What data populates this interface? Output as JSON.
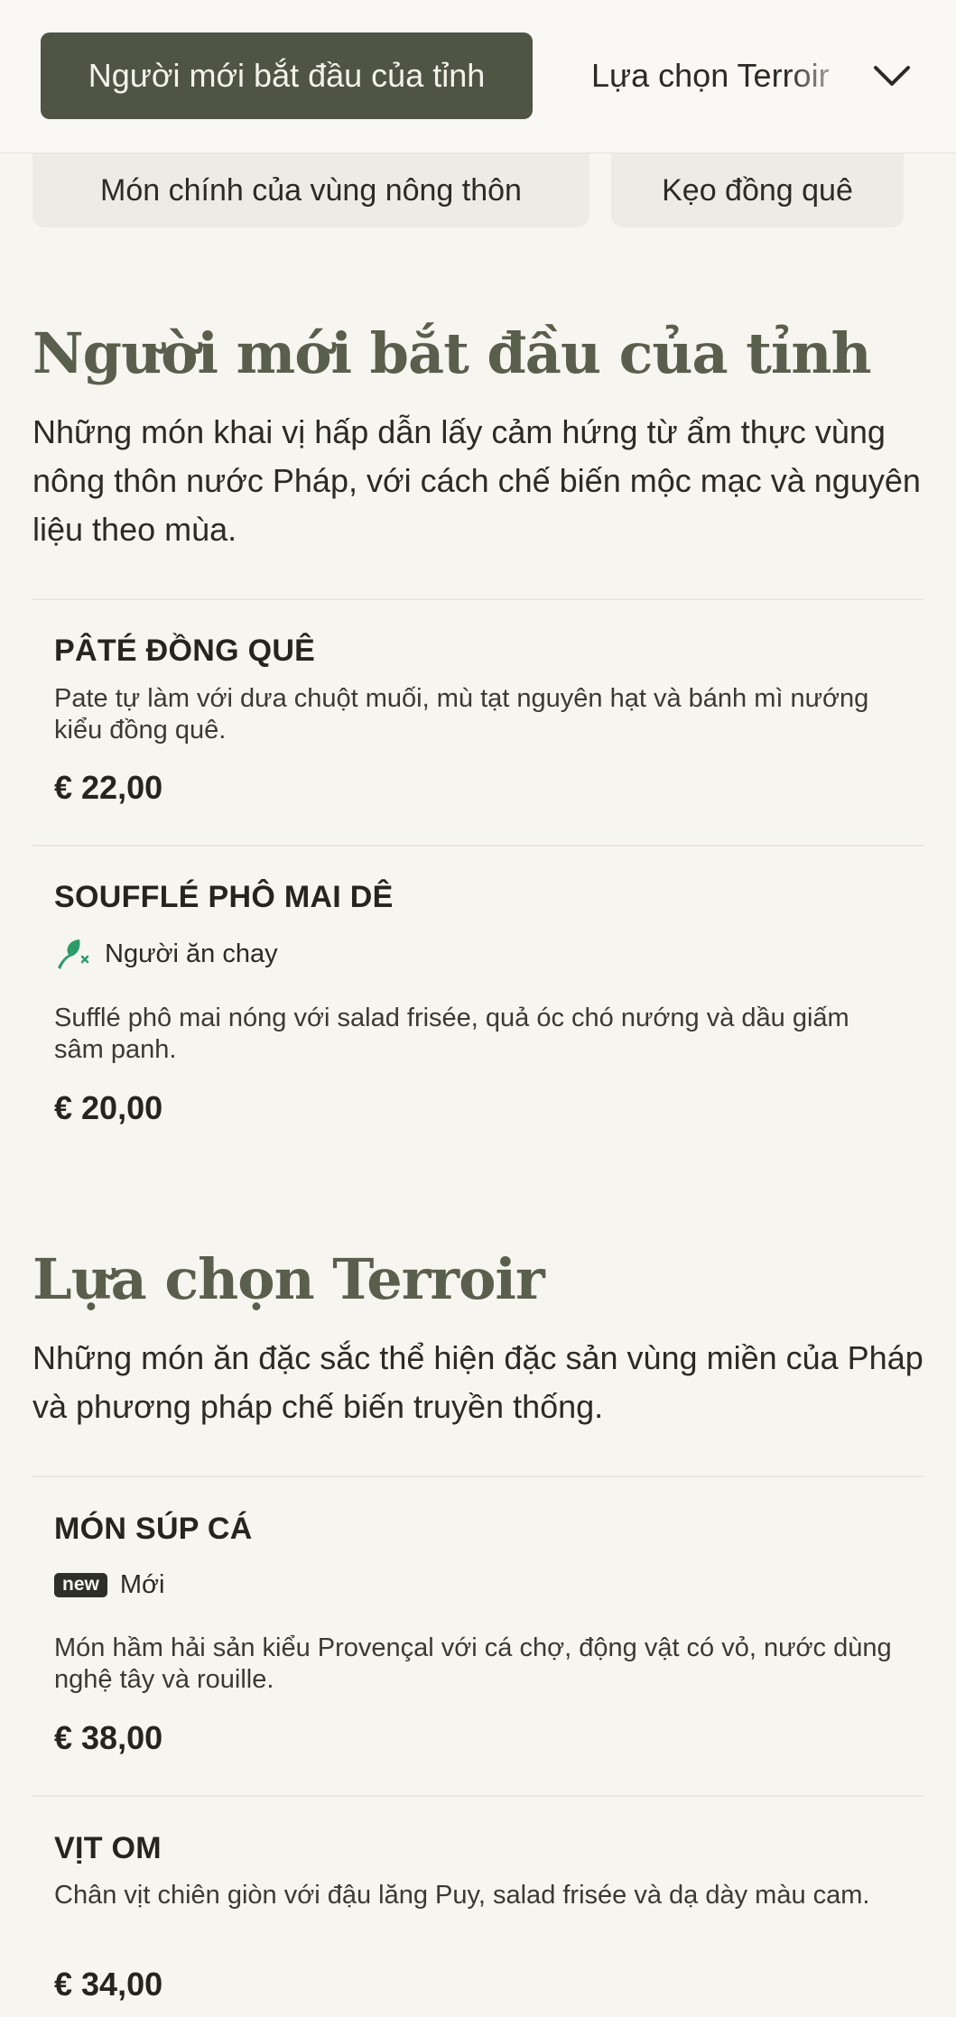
{
  "nav": {
    "active_tab": "Người mới bắt đầu của tỉnh",
    "next_tab": "Lựa chọn Terroir",
    "chevron_icon": "chevron-down-icon",
    "pills": [
      "Món chính của vùng nông thôn",
      "Kẹo đồng quê"
    ]
  },
  "sections": [
    {
      "title": "Người mới bắt đầu của tỉnh",
      "description": "Những món khai vị hấp dẫn lấy cảm hứng từ ẩm thực vùng nông thôn nước Pháp, với cách chế biến mộc mạc và nguyên liệu theo mùa.",
      "items": [
        {
          "name": "PÂTÉ ĐỒNG QUÊ",
          "description": "Pate tự làm với dưa chuột muối, mù tạt nguyên hạt và bánh mì nướng kiểu đồng quê.",
          "price": "€ 22,00"
        },
        {
          "name": "SOUFFLÉ PHÔ MAI DÊ",
          "tag": "Người ăn chay",
          "tag_icon": "vegetarian-leaf-icon",
          "description": "Sufflé phô mai nóng với salad frisée, quả óc chó nướng và dầu giấm sâm panh.",
          "price": "€ 20,00"
        }
      ]
    },
    {
      "title": "Lựa chọn Terroir",
      "description": "Những món ăn đặc sắc thể hiện đặc sản vùng miền của Pháp và phương pháp chế biến truyền thống.",
      "items": [
        {
          "name": "MÓN SÚP CÁ",
          "badge": "new",
          "tag": "Mới",
          "description": "Món hầm hải sản kiểu Provençal với cá chợ, động vật có vỏ, nước dùng nghệ tây và rouille.",
          "price": "€ 38,00"
        },
        {
          "name": "VỊT OM",
          "description": "Chân vịt chiên giòn với đậu lăng Puy, salad frisée và dạ dày màu cam.",
          "price": "€ 34,00"
        }
      ]
    }
  ],
  "colors": {
    "background": "#f7f5ef",
    "active_tab": "#4f5444",
    "heading": "#5a5e4c",
    "vegetarian": "#2e9b6a"
  }
}
